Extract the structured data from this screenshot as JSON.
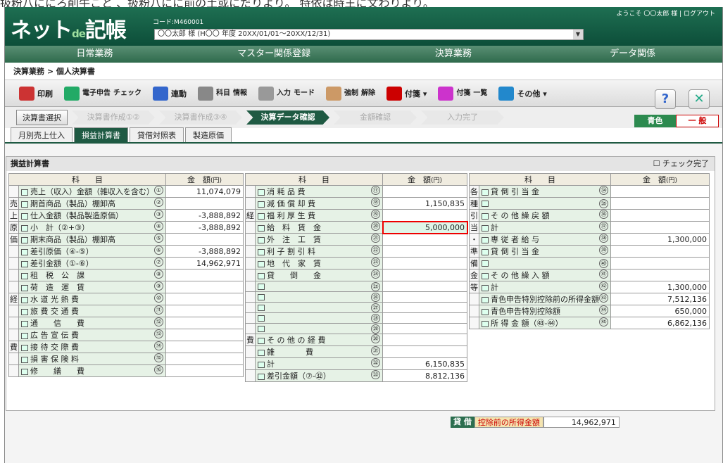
{
  "top_note": "扱粉八ににろ削牛こと 、扱粉八にに前の土或にだりより。 特依は時王に文わりより。",
  "app": {
    "logo_main": "ネット",
    "logo_de": "de",
    "logo_tail": "記帳",
    "code": "コード:M460001",
    "user_period": "〇〇太郎 様 (H〇〇 年度 20XX/01/01〜20XX/12/31)",
    "welcome": "ようこそ 〇〇太郎 様 | ログアウト"
  },
  "menu": [
    "日常業務",
    "マスター関係登録",
    "決算業務",
    "データ関係"
  ],
  "breadcrumb": "決算業務 > 個人決算書",
  "toolbar": [
    {
      "l1": "印刷",
      "l2": "",
      "icon": "printer-icon",
      "color": "#c33"
    },
    {
      "l1": "電子申告",
      "l2": "チェック",
      "icon": "e-check-icon",
      "color": "#2a6"
    },
    {
      "l1": "連動",
      "l2": "",
      "icon": "link-icon",
      "color": "#36c"
    },
    {
      "l1": "科目",
      "l2": "情報",
      "icon": "info-icon",
      "color": "#888"
    },
    {
      "l1": "入力",
      "l2": "モード",
      "icon": "gear-icon",
      "color": "#999"
    },
    {
      "l1": "強制",
      "l2": "解除",
      "icon": "release-icon",
      "color": "#c96"
    },
    {
      "l1": "付箋 ▾",
      "l2": "",
      "icon": "sticky-icon",
      "color": "#c00"
    },
    {
      "l1": "付箋",
      "l2": "一覧",
      "icon": "sticky-list-icon",
      "color": "#c3c"
    },
    {
      "l1": "その他 ▾",
      "l2": "",
      "icon": "other-icon",
      "color": "#28c"
    }
  ],
  "help": "?",
  "close": "✕",
  "select_btn": "決算書選択",
  "steps": [
    {
      "label": "決算書作成①②",
      "on": false
    },
    {
      "label": "決算書作成③④",
      "on": false
    },
    {
      "label": "決算データ確認",
      "on": true
    },
    {
      "label": "金額確認",
      "on": false
    },
    {
      "label": "入力完了",
      "on": false
    }
  ],
  "blue": {
    "g": "青色",
    "r": "一 般"
  },
  "tabs": [
    {
      "label": "月別売上仕入",
      "on": false
    },
    {
      "label": "損益計算書",
      "on": true
    },
    {
      "label": "貸借対照表",
      "on": false
    },
    {
      "label": "製造原価",
      "on": false
    }
  ],
  "panel": {
    "title": "損益計算書",
    "check": "☐ チェック完了"
  },
  "h": {
    "km": "科　　目",
    "kg": "金　額",
    "unit": "(円)"
  },
  "c1": [
    {
      "side": "",
      "label": "売上（収入）金額（雑収入を含む）",
      "n": "①",
      "v": "11,074,079"
    },
    {
      "side": "売",
      "label": "期首商品（製品）棚卸高",
      "n": "②",
      "v": ""
    },
    {
      "side": "上",
      "label": "仕入金額（製品製造原価）",
      "n": "③",
      "v": "-3,888,892"
    },
    {
      "side": "原",
      "label": "小　計（②+③）",
      "n": "④",
      "v": "-3,888,892"
    },
    {
      "side": "価",
      "label": "期末商品（製品）棚卸高",
      "n": "⑤",
      "v": ""
    },
    {
      "side": "",
      "label": "差引原価（④-⑤）",
      "n": "⑥",
      "v": "-3,888,892"
    },
    {
      "side": "",
      "label": "差引金額（①-⑥）",
      "n": "⑦",
      "v": "14,962,971"
    },
    {
      "side": "",
      "label": "租　税　公　課",
      "n": "⑧",
      "v": ""
    },
    {
      "side": "",
      "label": "荷　造　運　賃",
      "n": "⑨",
      "v": ""
    },
    {
      "side": "経",
      "label": "水 道 光 熱 費",
      "n": "⑩",
      "v": ""
    },
    {
      "side": "",
      "label": "旅 費 交 通 費",
      "n": "⑪",
      "v": ""
    },
    {
      "side": "",
      "label": "通　　信　　費",
      "n": "⑫",
      "v": ""
    },
    {
      "side": "",
      "label": "広 告 宣 伝 費",
      "n": "⑬",
      "v": ""
    },
    {
      "side": "費",
      "label": "接 待 交 際 費",
      "n": "⑭",
      "v": ""
    },
    {
      "side": "",
      "label": "損 害 保 険 料",
      "n": "⑮",
      "v": ""
    },
    {
      "side": "",
      "label": "修　　繕　　費",
      "n": "⑯",
      "v": ""
    }
  ],
  "c2": [
    {
      "side": "",
      "label": "消 耗 品 費",
      "n": "⑰",
      "v": ""
    },
    {
      "side": "",
      "label": "減 価 償 却 費",
      "n": "⑱",
      "v": "1,150,835"
    },
    {
      "side": "経",
      "label": "福 利 厚 生 費",
      "n": "⑲",
      "v": ""
    },
    {
      "side": "",
      "label": "給　料　賃　金",
      "n": "⑳",
      "v": "5,000,000"
    },
    {
      "side": "",
      "label": "外　注　工　賃",
      "n": "㉑",
      "v": ""
    },
    {
      "side": "",
      "label": "利 子 割 引 料",
      "n": "㉒",
      "v": ""
    },
    {
      "side": "",
      "label": "地　代　家　賃",
      "n": "㉓",
      "v": ""
    },
    {
      "side": "",
      "label": "貸　　倒　　金",
      "n": "㉔",
      "v": ""
    },
    {
      "side": "",
      "label": "",
      "n": "㉕",
      "v": ""
    },
    {
      "side": "",
      "label": "",
      "n": "㉖",
      "v": ""
    },
    {
      "side": "",
      "label": "",
      "n": "㉗",
      "v": ""
    },
    {
      "side": "",
      "label": "",
      "n": "㉘",
      "v": ""
    },
    {
      "side": "",
      "label": "",
      "n": "㉙",
      "v": ""
    },
    {
      "side": "費",
      "label": "そ の 他 の 経 費",
      "n": "㉚",
      "v": ""
    },
    {
      "side": "",
      "label": "雑　　　　費",
      "n": "㉛",
      "v": ""
    },
    {
      "side": "",
      "label": "計",
      "n": "㉜",
      "v": "6,150,835"
    },
    {
      "side": "",
      "label": "差引金額（⑦-㉜）",
      "n": "㉝",
      "v": "8,812,136"
    }
  ],
  "c3": [
    {
      "side": "各",
      "label": "貸 倒 引 当 金",
      "n": "㉞",
      "v": ""
    },
    {
      "side": "種",
      "label": "",
      "n": "㉟",
      "v": ""
    },
    {
      "side": "引",
      "label": "そ の 他 繰 戻 額",
      "n": "㊱",
      "v": ""
    },
    {
      "side": "当",
      "label": "計",
      "n": "㊲",
      "v": ""
    },
    {
      "side": "・",
      "label": "専 従 者 給 与",
      "n": "㊳",
      "v": "1,300,000"
    },
    {
      "side": "準",
      "label": "貸 倒 引 当 金",
      "n": "㊴",
      "v": ""
    },
    {
      "side": "備",
      "label": "",
      "n": "㊵",
      "v": ""
    },
    {
      "side": "金",
      "label": "そ の 他 繰 入 額",
      "n": "㊶",
      "v": ""
    },
    {
      "side": "等",
      "label": "計",
      "n": "㊷",
      "v": "1,300,000"
    },
    {
      "side": "",
      "label": "青色申告特別控除前の所得金額",
      "n": "㊸",
      "v": "7,512,136"
    },
    {
      "side": "",
      "label": "青色申告特別控除額",
      "n": "㊹",
      "v": "650,000"
    },
    {
      "side": "",
      "label": "所 得 金 額（㊸-㊹）",
      "n": "㊺",
      "v": "6,862,136"
    }
  ],
  "kashi": {
    "a": "貸 借",
    "b": "控除前の所得金額",
    "v": "14,962,971"
  }
}
